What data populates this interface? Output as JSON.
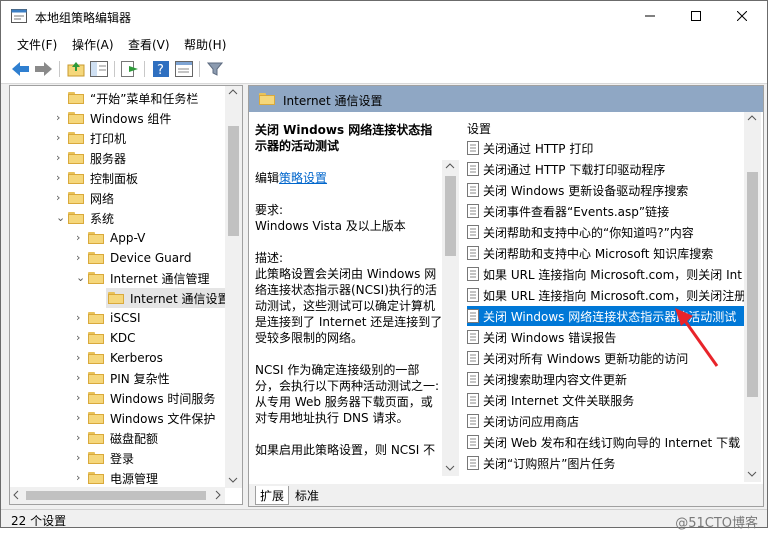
{
  "window": {
    "title": "本地组策略编辑器",
    "minimize": "—",
    "maximize": "☐",
    "close": "✕"
  },
  "menu": [
    "文件(F)",
    "操作(A)",
    "查看(V)",
    "帮助(H)"
  ],
  "tree": {
    "items": [
      {
        "label": "“开始”菜单和任务栏",
        "expanded": false
      },
      {
        "label": "Windows 组件",
        "expanded": false
      },
      {
        "label": "打印机",
        "expanded": false
      },
      {
        "label": "服务器",
        "expanded": false
      },
      {
        "label": "控制面板",
        "expanded": false
      },
      {
        "label": "网络",
        "expanded": false
      },
      {
        "label": "系统",
        "expanded": true
      },
      {
        "label": "App-V",
        "expanded": false
      },
      {
        "label": "Device Guard",
        "expanded": false
      },
      {
        "label": "Internet 通信管理",
        "expanded": true
      },
      {
        "label": "Internet 通信设置",
        "selected": true
      },
      {
        "label": "iSCSI",
        "expanded": false
      },
      {
        "label": "KDC",
        "expanded": false
      },
      {
        "label": "Kerberos",
        "expanded": false
      },
      {
        "label": "PIN 复杂性",
        "expanded": false
      },
      {
        "label": "Windows 时间服务",
        "expanded": false
      },
      {
        "label": "Windows 文件保护",
        "expanded": false
      },
      {
        "label": "磁盘配额",
        "expanded": false
      },
      {
        "label": "登录",
        "expanded": false
      },
      {
        "label": "电源管理",
        "expanded": false
      }
    ]
  },
  "panel": {
    "header": "Internet 通信设置"
  },
  "description": {
    "title": "关闭 Windows 网络连接状态指示器的活动测试",
    "edit_prefix": "编辑",
    "edit_link": "策略设置",
    "req_label": "要求:",
    "req_value": "Windows Vista 及以上版本",
    "desc_label": "描述:",
    "desc_text": "此策略设置会关闭由 Windows 网络连接状态指示器(NCSI)执行的活动测试，这些测试可以确定计算机是连接到了 Internet 还是连接到了受较多限制的网络。",
    "desc_text2": "NCSI 作为确定连接级别的一部分，会执行以下两种活动测试之一: 从专用 Web 服务器下载页面，或对专用地址执行 DNS 请求。",
    "desc_text3": "如果启用此策略设置，则 NCSI 不"
  },
  "settings": {
    "header": "设置",
    "items": [
      "关闭通过 HTTP 打印",
      "关闭通过 HTTP 下载打印驱动程序",
      "关闭 Windows 更新设备驱动程序搜索",
      "关闭事件查看器“Events.asp”链接",
      "关闭帮助和支持中心的“你知道吗?”内容",
      "关闭帮助和支持中心 Microsoft 知识库搜索",
      "如果 URL 连接指向 Microsoft.com，则关闭 Int",
      "如果 URL 连接指向 Microsoft.com，则关闭注册",
      "关闭 Windows 网络连接状态指示器的活动测试",
      "关闭 Windows 错误报告",
      "关闭对所有 Windows 更新功能的访问",
      "关闭搜索助理内容文件更新",
      "关闭 Internet 文件关联服务",
      "关闭访问应用商店",
      "关闭 Web 发布和在线订购向导的 Internet 下载",
      "关闭“订购照片”图片任务"
    ],
    "selected_index": 8
  },
  "tabs": [
    "扩展",
    "标准"
  ],
  "status": "22 个设置",
  "watermark": "@51CTO博客",
  "colors": {
    "selection": "#0078d7",
    "header": "#8fa7c4",
    "arrow": "#e8242a"
  }
}
